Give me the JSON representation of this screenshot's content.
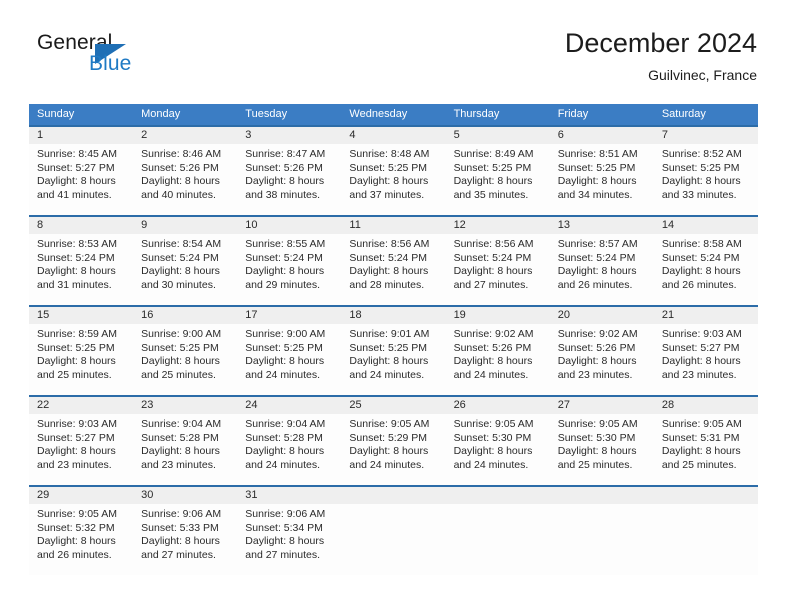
{
  "brand": {
    "name_top": "General",
    "name_bottom": "Blue",
    "accent_color": "#1f7ac4"
  },
  "header": {
    "title": "December 2024",
    "location": "Guilvinec, France"
  },
  "theme": {
    "header_row_bg": "#3b7dc4",
    "week_separator": "#2c6ca8",
    "date_band_bg": "#efefef",
    "cell_bg": "#fdfdfd",
    "text_color": "#2b2b2b"
  },
  "calendar": {
    "day_headers": [
      "Sunday",
      "Monday",
      "Tuesday",
      "Wednesday",
      "Thursday",
      "Friday",
      "Saturday"
    ],
    "weeks": [
      [
        {
          "day": "1",
          "sunrise": "Sunrise: 8:45 AM",
          "sunset": "Sunset: 5:27 PM",
          "daylight_line1": "Daylight: 8 hours",
          "daylight_line2": "and 41 minutes."
        },
        {
          "day": "2",
          "sunrise": "Sunrise: 8:46 AM",
          "sunset": "Sunset: 5:26 PM",
          "daylight_line1": "Daylight: 8 hours",
          "daylight_line2": "and 40 minutes."
        },
        {
          "day": "3",
          "sunrise": "Sunrise: 8:47 AM",
          "sunset": "Sunset: 5:26 PM",
          "daylight_line1": "Daylight: 8 hours",
          "daylight_line2": "and 38 minutes."
        },
        {
          "day": "4",
          "sunrise": "Sunrise: 8:48 AM",
          "sunset": "Sunset: 5:25 PM",
          "daylight_line1": "Daylight: 8 hours",
          "daylight_line2": "and 37 minutes."
        },
        {
          "day": "5",
          "sunrise": "Sunrise: 8:49 AM",
          "sunset": "Sunset: 5:25 PM",
          "daylight_line1": "Daylight: 8 hours",
          "daylight_line2": "and 35 minutes."
        },
        {
          "day": "6",
          "sunrise": "Sunrise: 8:51 AM",
          "sunset": "Sunset: 5:25 PM",
          "daylight_line1": "Daylight: 8 hours",
          "daylight_line2": "and 34 minutes."
        },
        {
          "day": "7",
          "sunrise": "Sunrise: 8:52 AM",
          "sunset": "Sunset: 5:25 PM",
          "daylight_line1": "Daylight: 8 hours",
          "daylight_line2": "and 33 minutes."
        }
      ],
      [
        {
          "day": "8",
          "sunrise": "Sunrise: 8:53 AM",
          "sunset": "Sunset: 5:24 PM",
          "daylight_line1": "Daylight: 8 hours",
          "daylight_line2": "and 31 minutes."
        },
        {
          "day": "9",
          "sunrise": "Sunrise: 8:54 AM",
          "sunset": "Sunset: 5:24 PM",
          "daylight_line1": "Daylight: 8 hours",
          "daylight_line2": "and 30 minutes."
        },
        {
          "day": "10",
          "sunrise": "Sunrise: 8:55 AM",
          "sunset": "Sunset: 5:24 PM",
          "daylight_line1": "Daylight: 8 hours",
          "daylight_line2": "and 29 minutes."
        },
        {
          "day": "11",
          "sunrise": "Sunrise: 8:56 AM",
          "sunset": "Sunset: 5:24 PM",
          "daylight_line1": "Daylight: 8 hours",
          "daylight_line2": "and 28 minutes."
        },
        {
          "day": "12",
          "sunrise": "Sunrise: 8:56 AM",
          "sunset": "Sunset: 5:24 PM",
          "daylight_line1": "Daylight: 8 hours",
          "daylight_line2": "and 27 minutes."
        },
        {
          "day": "13",
          "sunrise": "Sunrise: 8:57 AM",
          "sunset": "Sunset: 5:24 PM",
          "daylight_line1": "Daylight: 8 hours",
          "daylight_line2": "and 26 minutes."
        },
        {
          "day": "14",
          "sunrise": "Sunrise: 8:58 AM",
          "sunset": "Sunset: 5:24 PM",
          "daylight_line1": "Daylight: 8 hours",
          "daylight_line2": "and 26 minutes."
        }
      ],
      [
        {
          "day": "15",
          "sunrise": "Sunrise: 8:59 AM",
          "sunset": "Sunset: 5:25 PM",
          "daylight_line1": "Daylight: 8 hours",
          "daylight_line2": "and 25 minutes."
        },
        {
          "day": "16",
          "sunrise": "Sunrise: 9:00 AM",
          "sunset": "Sunset: 5:25 PM",
          "daylight_line1": "Daylight: 8 hours",
          "daylight_line2": "and 25 minutes."
        },
        {
          "day": "17",
          "sunrise": "Sunrise: 9:00 AM",
          "sunset": "Sunset: 5:25 PM",
          "daylight_line1": "Daylight: 8 hours",
          "daylight_line2": "and 24 minutes."
        },
        {
          "day": "18",
          "sunrise": "Sunrise: 9:01 AM",
          "sunset": "Sunset: 5:25 PM",
          "daylight_line1": "Daylight: 8 hours",
          "daylight_line2": "and 24 minutes."
        },
        {
          "day": "19",
          "sunrise": "Sunrise: 9:02 AM",
          "sunset": "Sunset: 5:26 PM",
          "daylight_line1": "Daylight: 8 hours",
          "daylight_line2": "and 24 minutes."
        },
        {
          "day": "20",
          "sunrise": "Sunrise: 9:02 AM",
          "sunset": "Sunset: 5:26 PM",
          "daylight_line1": "Daylight: 8 hours",
          "daylight_line2": "and 23 minutes."
        },
        {
          "day": "21",
          "sunrise": "Sunrise: 9:03 AM",
          "sunset": "Sunset: 5:27 PM",
          "daylight_line1": "Daylight: 8 hours",
          "daylight_line2": "and 23 minutes."
        }
      ],
      [
        {
          "day": "22",
          "sunrise": "Sunrise: 9:03 AM",
          "sunset": "Sunset: 5:27 PM",
          "daylight_line1": "Daylight: 8 hours",
          "daylight_line2": "and 23 minutes."
        },
        {
          "day": "23",
          "sunrise": "Sunrise: 9:04 AM",
          "sunset": "Sunset: 5:28 PM",
          "daylight_line1": "Daylight: 8 hours",
          "daylight_line2": "and 23 minutes."
        },
        {
          "day": "24",
          "sunrise": "Sunrise: 9:04 AM",
          "sunset": "Sunset: 5:28 PM",
          "daylight_line1": "Daylight: 8 hours",
          "daylight_line2": "and 24 minutes."
        },
        {
          "day": "25",
          "sunrise": "Sunrise: 9:05 AM",
          "sunset": "Sunset: 5:29 PM",
          "daylight_line1": "Daylight: 8 hours",
          "daylight_line2": "and 24 minutes."
        },
        {
          "day": "26",
          "sunrise": "Sunrise: 9:05 AM",
          "sunset": "Sunset: 5:30 PM",
          "daylight_line1": "Daylight: 8 hours",
          "daylight_line2": "and 24 minutes."
        },
        {
          "day": "27",
          "sunrise": "Sunrise: 9:05 AM",
          "sunset": "Sunset: 5:30 PM",
          "daylight_line1": "Daylight: 8 hours",
          "daylight_line2": "and 25 minutes."
        },
        {
          "day": "28",
          "sunrise": "Sunrise: 9:05 AM",
          "sunset": "Sunset: 5:31 PM",
          "daylight_line1": "Daylight: 8 hours",
          "daylight_line2": "and 25 minutes."
        }
      ],
      [
        {
          "day": "29",
          "sunrise": "Sunrise: 9:05 AM",
          "sunset": "Sunset: 5:32 PM",
          "daylight_line1": "Daylight: 8 hours",
          "daylight_line2": "and 26 minutes."
        },
        {
          "day": "30",
          "sunrise": "Sunrise: 9:06 AM",
          "sunset": "Sunset: 5:33 PM",
          "daylight_line1": "Daylight: 8 hours",
          "daylight_line2": "and 27 minutes."
        },
        {
          "day": "31",
          "sunrise": "Sunrise: 9:06 AM",
          "sunset": "Sunset: 5:34 PM",
          "daylight_line1": "Daylight: 8 hours",
          "daylight_line2": "and 27 minutes."
        },
        {
          "day": "",
          "sunrise": "",
          "sunset": "",
          "daylight_line1": "",
          "daylight_line2": ""
        },
        {
          "day": "",
          "sunrise": "",
          "sunset": "",
          "daylight_line1": "",
          "daylight_line2": ""
        },
        {
          "day": "",
          "sunrise": "",
          "sunset": "",
          "daylight_line1": "",
          "daylight_line2": ""
        },
        {
          "day": "",
          "sunrise": "",
          "sunset": "",
          "daylight_line1": "",
          "daylight_line2": ""
        }
      ]
    ]
  }
}
